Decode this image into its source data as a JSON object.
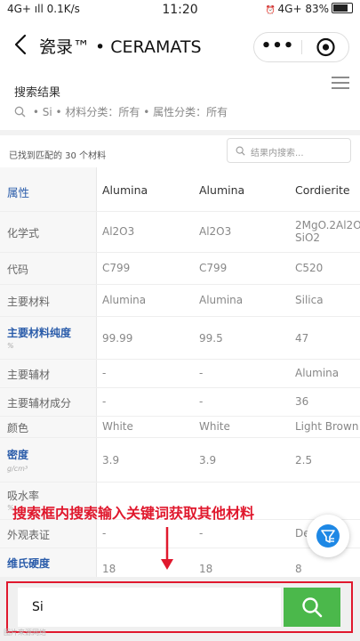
{
  "status_bar": {
    "network": "4G+ ıll 0.1K/s",
    "time": "11:20",
    "right": "4G+ 83%"
  },
  "nav": {
    "title": "瓷录™ • CERAMATS",
    "more": "•••"
  },
  "search_result": {
    "title": "搜索结果",
    "crumbs": [
      "Si",
      "材料分类：所有",
      "属性分类：所有"
    ],
    "found": "已找到匹配的 30 个材料",
    "inner_placeholder": "结果内搜索..."
  },
  "table": {
    "header": {
      "prop": "属性",
      "cols": [
        "Alumina",
        "Alumina",
        "Cordierite"
      ]
    },
    "rows": [
      {
        "label": "化学式",
        "v1": "Al2O3",
        "v2": "Al2O3",
        "v3": "2MgO.2Al2O3.5",
        "v3b": "SiO2"
      },
      {
        "label": "代码",
        "v1": "C799",
        "v2": "C799",
        "v3": "C520"
      },
      {
        "label": "主要材料",
        "v1": "Alumina",
        "v2": "Alumina",
        "v3": "Silica"
      },
      {
        "label": "主要材料纯度",
        "unit": "%",
        "v1": "99.99",
        "v2": "99.5",
        "v3": "47"
      },
      {
        "label": "主要辅材",
        "v1": "-",
        "v2": "-",
        "v3": "Alumina"
      },
      {
        "label": "主要辅材成分",
        "v1": "-",
        "v2": "-",
        "v3": "36"
      },
      {
        "label": "颜色",
        "v1": "White",
        "v2": "White",
        "v3": "Light Brown"
      },
      {
        "label": "密度",
        "unit": "g/cm³",
        "v1": "3.9",
        "v2": "3.9",
        "v3": "2.5"
      },
      {
        "label": "吸水率",
        "unit": "%"
      },
      {
        "label": "外观表证",
        "v1": "-",
        "v2": "-",
        "v3": "De"
      },
      {
        "label": "维氏硬度",
        "v1": "18",
        "v2": "18",
        "v3": "8"
      }
    ]
  },
  "annotation": "搜索框内搜索输入关键词获取其他材料",
  "bottom_search": {
    "value": "Si"
  },
  "watermark": "图片来源网络",
  "colors": {
    "accent_blue": "#2a5caa",
    "search_green": "#4bb84b",
    "annotation_red": "#e0182d"
  }
}
